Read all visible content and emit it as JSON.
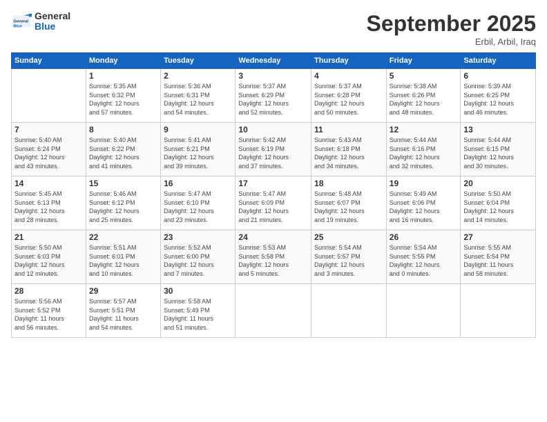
{
  "logo": {
    "general": "General",
    "blue": "Blue"
  },
  "header": {
    "month": "September 2025",
    "location": "Erbil, Arbil, Iraq"
  },
  "weekdays": [
    "Sunday",
    "Monday",
    "Tuesday",
    "Wednesday",
    "Thursday",
    "Friday",
    "Saturday"
  ],
  "weeks": [
    [
      {
        "day": "",
        "info": ""
      },
      {
        "day": "1",
        "info": "Sunrise: 5:35 AM\nSunset: 6:32 PM\nDaylight: 12 hours\nand 57 minutes."
      },
      {
        "day": "2",
        "info": "Sunrise: 5:36 AM\nSunset: 6:31 PM\nDaylight: 12 hours\nand 54 minutes."
      },
      {
        "day": "3",
        "info": "Sunrise: 5:37 AM\nSunset: 6:29 PM\nDaylight: 12 hours\nand 52 minutes."
      },
      {
        "day": "4",
        "info": "Sunrise: 5:37 AM\nSunset: 6:28 PM\nDaylight: 12 hours\nand 50 minutes."
      },
      {
        "day": "5",
        "info": "Sunrise: 5:38 AM\nSunset: 6:26 PM\nDaylight: 12 hours\nand 48 minutes."
      },
      {
        "day": "6",
        "info": "Sunrise: 5:39 AM\nSunset: 6:25 PM\nDaylight: 12 hours\nand 46 minutes."
      }
    ],
    [
      {
        "day": "7",
        "info": "Sunrise: 5:40 AM\nSunset: 6:24 PM\nDaylight: 12 hours\nand 43 minutes."
      },
      {
        "day": "8",
        "info": "Sunrise: 5:40 AM\nSunset: 6:22 PM\nDaylight: 12 hours\nand 41 minutes."
      },
      {
        "day": "9",
        "info": "Sunrise: 5:41 AM\nSunset: 6:21 PM\nDaylight: 12 hours\nand 39 minutes."
      },
      {
        "day": "10",
        "info": "Sunrise: 5:42 AM\nSunset: 6:19 PM\nDaylight: 12 hours\nand 37 minutes."
      },
      {
        "day": "11",
        "info": "Sunrise: 5:43 AM\nSunset: 6:18 PM\nDaylight: 12 hours\nand 34 minutes."
      },
      {
        "day": "12",
        "info": "Sunrise: 5:44 AM\nSunset: 6:16 PM\nDaylight: 12 hours\nand 32 minutes."
      },
      {
        "day": "13",
        "info": "Sunrise: 5:44 AM\nSunset: 6:15 PM\nDaylight: 12 hours\nand 30 minutes."
      }
    ],
    [
      {
        "day": "14",
        "info": "Sunrise: 5:45 AM\nSunset: 6:13 PM\nDaylight: 12 hours\nand 28 minutes."
      },
      {
        "day": "15",
        "info": "Sunrise: 5:46 AM\nSunset: 6:12 PM\nDaylight: 12 hours\nand 25 minutes."
      },
      {
        "day": "16",
        "info": "Sunrise: 5:47 AM\nSunset: 6:10 PM\nDaylight: 12 hours\nand 23 minutes."
      },
      {
        "day": "17",
        "info": "Sunrise: 5:47 AM\nSunset: 6:09 PM\nDaylight: 12 hours\nand 21 minutes."
      },
      {
        "day": "18",
        "info": "Sunrise: 5:48 AM\nSunset: 6:07 PM\nDaylight: 12 hours\nand 19 minutes."
      },
      {
        "day": "19",
        "info": "Sunrise: 5:49 AM\nSunset: 6:06 PM\nDaylight: 12 hours\nand 16 minutes."
      },
      {
        "day": "20",
        "info": "Sunrise: 5:50 AM\nSunset: 6:04 PM\nDaylight: 12 hours\nand 14 minutes."
      }
    ],
    [
      {
        "day": "21",
        "info": "Sunrise: 5:50 AM\nSunset: 6:03 PM\nDaylight: 12 hours\nand 12 minutes."
      },
      {
        "day": "22",
        "info": "Sunrise: 5:51 AM\nSunset: 6:01 PM\nDaylight: 12 hours\nand 10 minutes."
      },
      {
        "day": "23",
        "info": "Sunrise: 5:52 AM\nSunset: 6:00 PM\nDaylight: 12 hours\nand 7 minutes."
      },
      {
        "day": "24",
        "info": "Sunrise: 5:53 AM\nSunset: 5:58 PM\nDaylight: 12 hours\nand 5 minutes."
      },
      {
        "day": "25",
        "info": "Sunrise: 5:54 AM\nSunset: 5:57 PM\nDaylight: 12 hours\nand 3 minutes."
      },
      {
        "day": "26",
        "info": "Sunrise: 5:54 AM\nSunset: 5:55 PM\nDaylight: 12 hours\nand 0 minutes."
      },
      {
        "day": "27",
        "info": "Sunrise: 5:55 AM\nSunset: 5:54 PM\nDaylight: 11 hours\nand 58 minutes."
      }
    ],
    [
      {
        "day": "28",
        "info": "Sunrise: 5:56 AM\nSunset: 5:52 PM\nDaylight: 11 hours\nand 56 minutes."
      },
      {
        "day": "29",
        "info": "Sunrise: 5:57 AM\nSunset: 5:51 PM\nDaylight: 11 hours\nand 54 minutes."
      },
      {
        "day": "30",
        "info": "Sunrise: 5:58 AM\nSunset: 5:49 PM\nDaylight: 11 hours\nand 51 minutes."
      },
      {
        "day": "",
        "info": ""
      },
      {
        "day": "",
        "info": ""
      },
      {
        "day": "",
        "info": ""
      },
      {
        "day": "",
        "info": ""
      }
    ]
  ]
}
